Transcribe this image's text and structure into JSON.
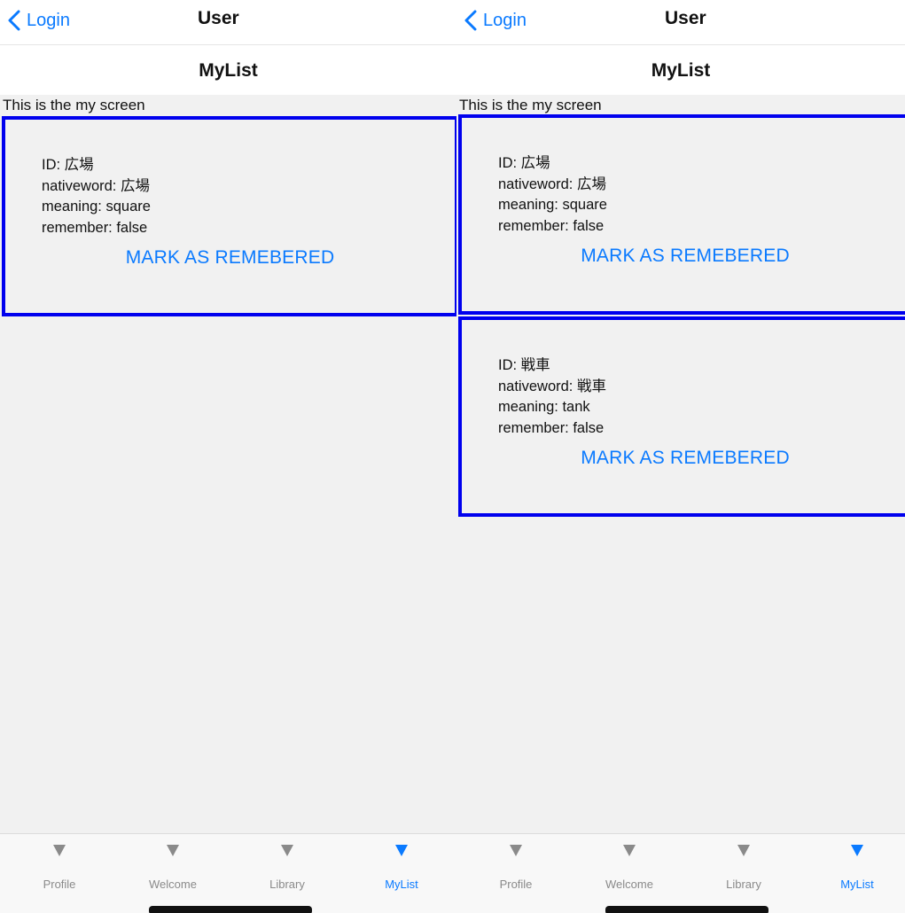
{
  "screens": [
    {
      "nav": {
        "back_label": "Login",
        "title": "User"
      },
      "header": {
        "title": "MyList"
      },
      "screen_text": "This is the my screen",
      "cards": [
        {
          "id": "ID: 広場",
          "nativeword": "nativeword: 広場",
          "meaning": "meaning: square",
          "remember": "remember: false",
          "button": "MARK AS REMEBERED"
        }
      ],
      "tabs": [
        {
          "label": "Profile"
        },
        {
          "label": "Welcome"
        },
        {
          "label": "Library"
        },
        {
          "label": "MyList"
        }
      ],
      "active_tab": "MyList"
    },
    {
      "nav": {
        "back_label": "Login",
        "title": "User"
      },
      "header": {
        "title": "MyList"
      },
      "screen_text": "This is the my screen",
      "cards": [
        {
          "id": "ID: 広場",
          "nativeword": "nativeword: 広場",
          "meaning": "meaning: square",
          "remember": "remember: false",
          "button": "MARK AS REMEBERED"
        },
        {
          "id": "ID: 戦車",
          "nativeword": "nativeword: 戦車",
          "meaning": "meaning: tank",
          "remember": "remember: false",
          "button": "MARK AS REMEBERED"
        }
      ],
      "tabs": [
        {
          "label": "Profile"
        },
        {
          "label": "Welcome"
        },
        {
          "label": "Library"
        },
        {
          "label": "MyList"
        }
      ],
      "active_tab": "MyList"
    }
  ],
  "colors": {
    "accent": "#0a7aff",
    "card_border": "#0000ee",
    "inactive": "#8a8a8a"
  },
  "icons": {
    "back": "chevron-left-icon",
    "tab": "triangle-down-icon"
  }
}
